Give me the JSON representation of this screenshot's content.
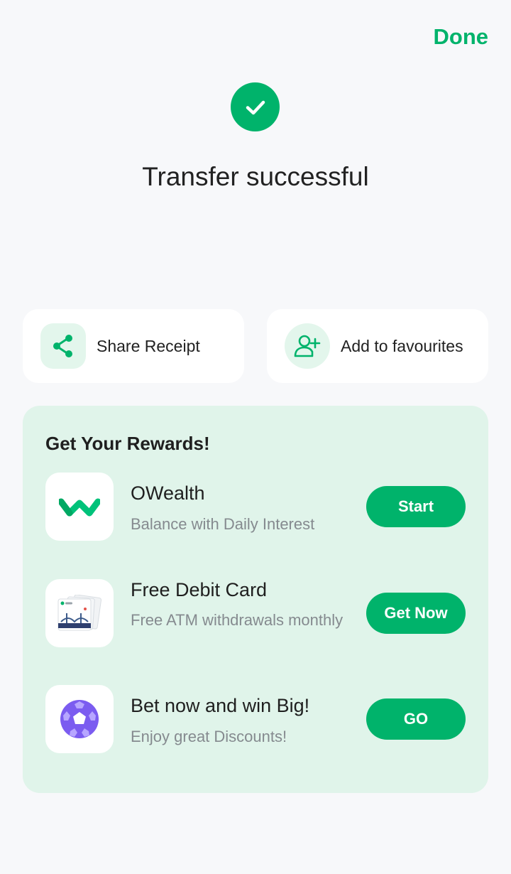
{
  "header": {
    "done_label": "Done"
  },
  "status": {
    "title": "Transfer successful",
    "icon": "check-icon",
    "color": "#00b36b"
  },
  "actions": {
    "share": {
      "label": "Share Receipt",
      "icon": "share-icon"
    },
    "favourites": {
      "label": "Add to favourites",
      "icon": "add-user-icon"
    }
  },
  "rewards": {
    "title": "Get Your Rewards!",
    "items": [
      {
        "name": "OWealth",
        "description": "Balance with Daily Interest",
        "button": "Start",
        "icon": "owealth-logo-icon"
      },
      {
        "name": "Free Debit Card",
        "description": "Free ATM withdrawals monthly",
        "button": "Get Now",
        "icon": "debit-card-icon"
      },
      {
        "name": "Bet now and win Big!",
        "description": "Enjoy great Discounts!",
        "button": "GO",
        "icon": "soccer-ball-icon"
      }
    ]
  },
  "colors": {
    "accent": "#00b36b",
    "rewards_bg": "#e0f4ea",
    "page_bg": "#f7f8fa"
  }
}
